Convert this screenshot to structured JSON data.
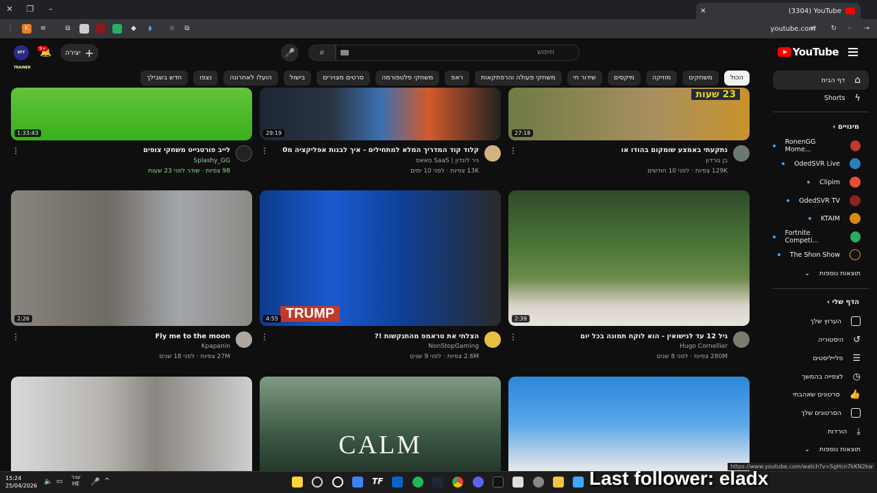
{
  "browser": {
    "tab_title": "(3304) YouTube",
    "url": "youtube.com",
    "status_url": "https://www.youtube.com/watch?v=SgHcn7kKN2kw"
  },
  "header": {
    "search_placeholder": "חיפוש",
    "create_label": "יצירה",
    "notif_count": "9+",
    "avatar_text": "EFY TRAINER",
    "logo_text": "YouTube"
  },
  "chips": [
    "הכול",
    "משחקים",
    "מוזיקה",
    "מיקסים",
    "שידור חי",
    "משחקי פעולה והרפתקאות",
    "ראפ",
    "משחקי פלטפורמה",
    "סרטים מצוירים",
    "בישול",
    "הועלו לאחרונה",
    "נצפו",
    "חדש בשבילך"
  ],
  "sidebar": {
    "home": "דף הבית",
    "shorts": "Shorts",
    "subs_head": "מינויים",
    "subs": [
      "RonenGG Mome...",
      "OdedSVR Live",
      "Clipim",
      "OdedSVR TV",
      "KTAIM",
      "Fortnite Competi...",
      "The Shon Show"
    ],
    "subs_more": "תוצאות נוספות",
    "you_head": "הדף שלי",
    "you_items": [
      "הערוץ שלך",
      "היסטוריה",
      "פלייליסטים",
      "לצפייה בהמשך",
      "סרטונים שאהבתי",
      "הסרטונים שלך",
      "הורדות",
      "תוצאות נוספות"
    ]
  },
  "videos": [
    {
      "title": "נתקעתי באמצע שומקום בהודו או",
      "channel": "בן גורדון",
      "meta": "129K צפיות · לפני 10 חודשים",
      "duration": "27:18"
    },
    {
      "title": "קלוד קוד המדריך המלא למתחילים - איך לבנות אפליקציה מ0",
      "channel": "ניר לונדון | SaaS סאאס",
      "meta": "13K צפיות · לפני 10 ימים",
      "duration": "29:19"
    },
    {
      "title": "לייב פורטנייט משחקי צופים",
      "channel": "Splashy_GG",
      "meta": "98 צפיות · שודר לפני 23 שעות",
      "duration": "1:33:43"
    },
    {
      "title": "גיל 12 עד לנישואין - הוא לוקח תמונה בכל יום",
      "channel": "Hugo Cornellier",
      "meta": "280M צפיות · לפני 8 שנים",
      "duration": "2:39"
    },
    {
      "title": "הצלתי את טראמפ מהתנקשות !?",
      "channel": "NonStopGaming",
      "meta": "2.6M צפיות · לפני 9 שנים",
      "duration": "4:55"
    },
    {
      "title": "Fly me to the moon",
      "channel": "Kpapanin",
      "meta": "27M צפיות · לפני 18 שנים",
      "duration": "2:26"
    }
  ],
  "thumb_text": {
    "calm": "CALM",
    "trump": "TRUMP",
    "hours23": "23 שעות"
  },
  "taskbar": {
    "time": "15:24",
    "date": "25/04/2026",
    "lang": "עבר",
    "lang2": "HE"
  },
  "overlay": "Last follower: eladx"
}
